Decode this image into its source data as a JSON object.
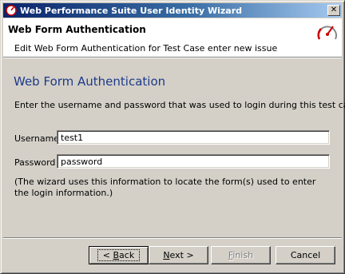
{
  "window": {
    "title": "Web Performance Suite User Identity Wizard",
    "close_glyph": "✕"
  },
  "header": {
    "title": "Web Form Authentication",
    "subtitle": "Edit Web Form Authentication for Test Case enter new issue"
  },
  "content": {
    "heading": "Web Form Authentication",
    "instruction": "Enter the username and password that was used to login during this test case.",
    "username_label": "Username",
    "username_value": "test1",
    "password_label": "Password",
    "password_value": "password",
    "note": "(The wizard uses this information to locate the form(s) used to enter the login information.)"
  },
  "buttons": {
    "back": {
      "mnemonic": "B",
      "rest": "ack",
      "prefix": "< "
    },
    "next": {
      "mnemonic": "N",
      "rest": "ext >"
    },
    "finish": {
      "mnemonic": "F",
      "rest": "inish"
    },
    "cancel": "Cancel"
  },
  "icons": {
    "app": "speedometer-icon",
    "wizard": "gauge-icon"
  },
  "colors": {
    "title_bar": "#0a246a",
    "heading": "#1c3a8a",
    "gauge_needle": "#cc0000"
  }
}
